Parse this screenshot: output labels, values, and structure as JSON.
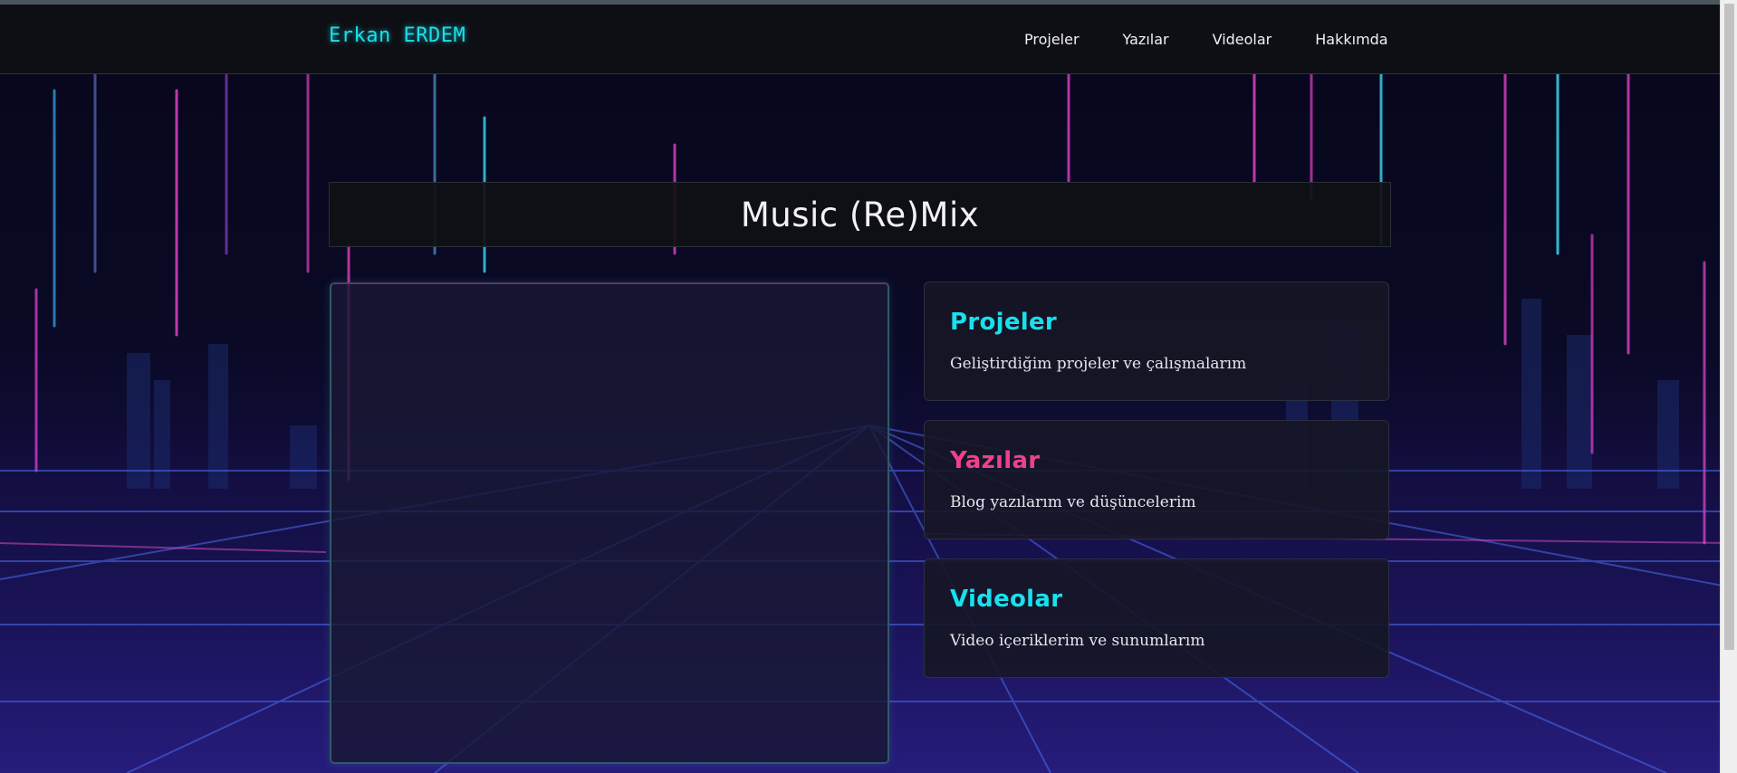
{
  "colors": {
    "accent_cyan": "#19e0ec",
    "accent_pink": "#f0408a",
    "header_bg": "#0e0f14",
    "text": "#f0f0f4"
  },
  "header": {
    "brand": "Erkan ERDEM",
    "nav": [
      "Projeler",
      "Yazılar",
      "Videolar",
      "Hakkımda"
    ]
  },
  "main": {
    "title": "Music (Re)Mix",
    "cards": [
      {
        "title": "Projeler",
        "description": "Geliştirdiğim projeler ve çalışmalarım",
        "color": "#19e0ec"
      },
      {
        "title": "Yazılar",
        "description": "Blog yazılarım ve düşüncelerim",
        "color": "#f0408a"
      },
      {
        "title": "Videolar",
        "description": "Video içeriklerim ve sunumlarım",
        "color": "#19e0ec"
      }
    ]
  }
}
